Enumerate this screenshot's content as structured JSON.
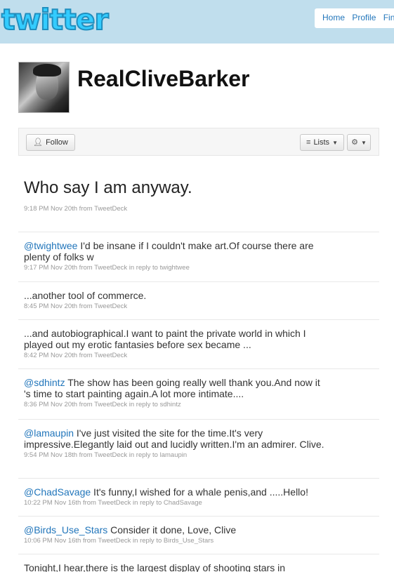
{
  "header": {
    "logo_text": "twitter",
    "nav": [
      "Home",
      "Profile",
      "Find People"
    ]
  },
  "profile": {
    "screen_name": "RealCliveBarker",
    "follow_label": "Follow",
    "lists_label": "Lists"
  },
  "lead_tweet": {
    "text": "Who say I am anyway.",
    "meta": "9:18 PM Nov 20th from TweetDeck"
  },
  "tweets": [
    {
      "mention": "@twightwee",
      "text": " I'd be insane if I couldn't make art.Of course there are plenty of folks w",
      "meta": "9:17 PM Nov 20th from TweetDeck in reply to twightwee"
    },
    {
      "mention": "",
      "text": "...another tool of commerce.",
      "meta": "8:45 PM Nov 20th from TweetDeck"
    },
    {
      "mention": "",
      "text": "...and autobiographical.I want to paint the private world in which I played out my erotic fantasies before sex became ...",
      "meta": "8:42 PM Nov 20th from TweetDeck"
    },
    {
      "mention": "@sdhintz",
      "text": " The show has been going really well thank you.And now it 's time to start painting again.A lot more intimate....",
      "meta": "8:36 PM Nov 20th from TweetDeck in reply to sdhintz"
    },
    {
      "mention": "@lamaupin",
      "text": " I've just visited the site for the time.It's very impressive.Elegantly laid out and lucidly written.I'm an admirer. Clive.",
      "meta": "9:54 PM Nov 18th from TweetDeck in reply to lamaupin"
    },
    {
      "mention": "@ChadSavage",
      "text": " It's funny,I wished for a whale penis,and .....Hello!",
      "meta": "10:22 PM Nov 16th from TweetDeck in reply to ChadSavage"
    },
    {
      "mention": "@Birds_Use_Stars",
      "text": " Consider it done, Love, Clive",
      "meta": "10:06 PM Nov 16th from TweetDeck in reply to Birds_Use_Stars"
    },
    {
      "mention": "",
      "text": "Tonight,I hear,there is the largest display of shooting stars in",
      "meta": ""
    }
  ],
  "colors": {
    "background": "#c0deed",
    "link": "#2276bb",
    "meta": "#999999"
  },
  "icons": {
    "follow": "add-person-icon",
    "lists": "list-icon",
    "settings": "gear-icon"
  }
}
